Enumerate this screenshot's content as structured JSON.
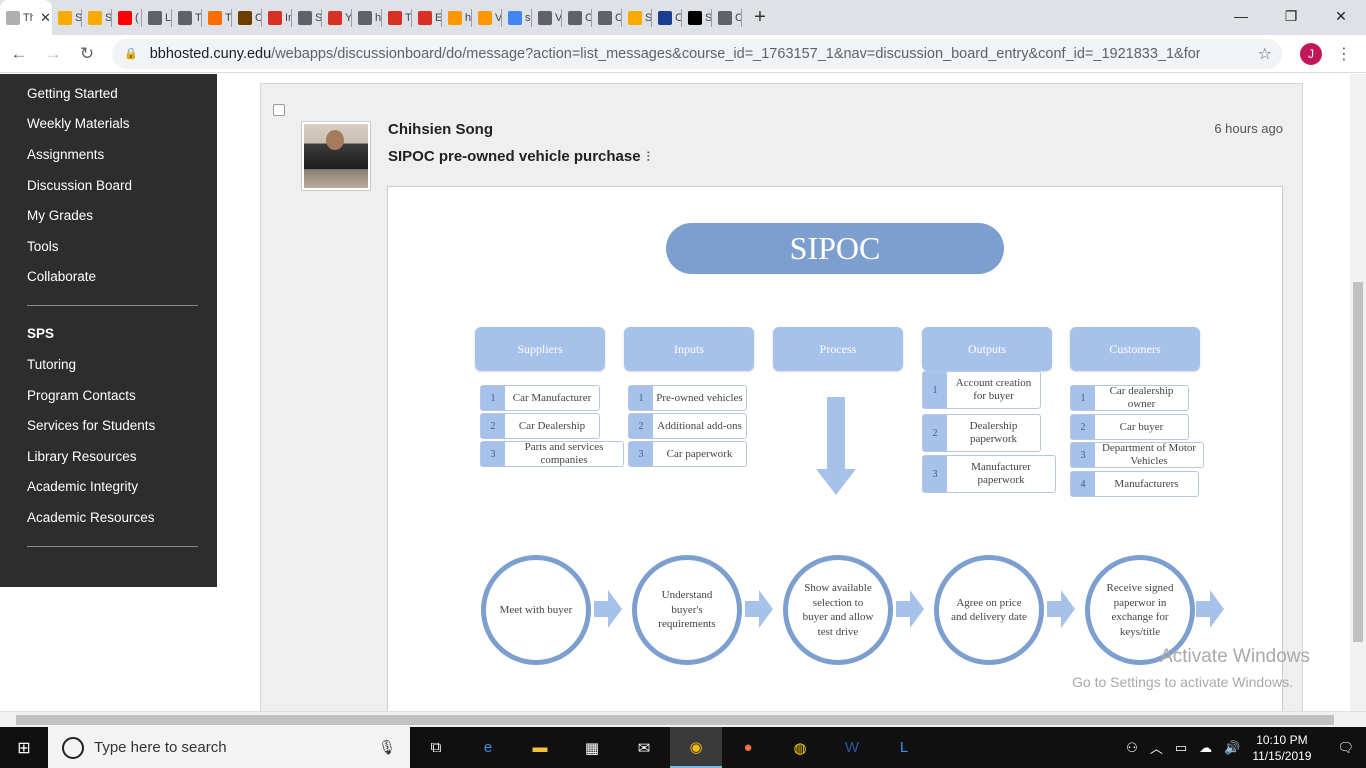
{
  "browser": {
    "tabs": [
      {
        "label": "Th",
        "active": true,
        "fav": "#b0b0b0"
      },
      {
        "label": "S",
        "fav": "#f9ab00"
      },
      {
        "label": "S",
        "fav": "#f9ab00"
      },
      {
        "label": "(",
        "fav": "#ff0000"
      },
      {
        "label": "L",
        "fav": "#5f6368"
      },
      {
        "label": "T",
        "fav": "#5f6368"
      },
      {
        "label": "T",
        "fav": "#ff6d00"
      },
      {
        "label": "C",
        "fav": "#6b3e00"
      },
      {
        "label": "In",
        "fav": "#d93025"
      },
      {
        "label": "S",
        "fav": "#5f6368"
      },
      {
        "label": "Y",
        "fav": "#d93025"
      },
      {
        "label": "h",
        "fav": "#5f6368"
      },
      {
        "label": "T",
        "fav": "#d93025"
      },
      {
        "label": "E",
        "fav": "#d93025"
      },
      {
        "label": "h",
        "fav": "#ff9800"
      },
      {
        "label": "V",
        "fav": "#ff9800"
      },
      {
        "label": "s",
        "fav": "#4285f4"
      },
      {
        "label": "V",
        "fav": "#5f6368"
      },
      {
        "label": "C",
        "fav": "#5f6368"
      },
      {
        "label": "C",
        "fav": "#5f6368"
      },
      {
        "label": "S",
        "fav": "#f9ab00"
      },
      {
        "label": "C",
        "fav": "#1a3d8f"
      },
      {
        "label": "S",
        "fav": "#000000"
      },
      {
        "label": "C",
        "fav": "#5f6368"
      }
    ],
    "close_glyph": "✕",
    "newtab_glyph": "+",
    "window": {
      "min": "—",
      "max": "❐",
      "close": "✕"
    },
    "url_domain": "bbhosted.cuny.edu",
    "url_path": "/webapps/discussionboard/do/message?action=list_messages&course_id=_1763157_1&nav=discussion_board_entry&conf_id=_1921833_1&forum_...",
    "profile_initial": "J"
  },
  "sidebar": {
    "items": [
      "Getting Started",
      "Weekly Materials",
      "Assignments",
      "Discussion Board",
      "My Grades",
      "Tools",
      "Collaborate"
    ],
    "section_head": "SPS",
    "section_items": [
      "Tutoring",
      "Program Contacts",
      "Services for Students",
      "Library Resources",
      "Academic Integrity",
      "Academic Resources"
    ]
  },
  "post": {
    "author": "Chihsien Song",
    "subject": "SIPOC pre-owned vehicle purchase",
    "time": "6 hours ago"
  },
  "diagram": {
    "title": "SIPOC",
    "columns": [
      {
        "header": "Suppliers",
        "items": [
          "Car Manufacturer",
          "Car Dealership",
          "Parts and services companies"
        ]
      },
      {
        "header": "Inputs",
        "items": [
          "Pre-owned vehicles",
          "Additional add-ons",
          "Car paperwork"
        ]
      },
      {
        "header": "Process",
        "items": []
      },
      {
        "header": "Outputs",
        "items": [
          "Account creation for buyer",
          "Dealership paperwork",
          "Manufacturer paperwork"
        ]
      },
      {
        "header": "Customers",
        "items": [
          "Car dealership owner",
          "Car buyer",
          "Department of Motor Vehicles",
          "Manufacturers"
        ]
      }
    ],
    "steps": [
      "Meet with buyer",
      "Understand buyer's requirements",
      "Show available selection to buyer and allow test drive",
      "Agree on price and delivery date",
      "Receive signed paperwor in exchange for keys/title"
    ],
    "colors": {
      "primary": "#7d9fd0",
      "light": "#a6c2ea"
    }
  },
  "watermark": {
    "line1": "Activate Windows",
    "line2": "Go to Settings to activate Windows."
  },
  "taskbar": {
    "search_placeholder": "Type here to search",
    "time": "10:10 PM",
    "date": "11/15/2019"
  }
}
